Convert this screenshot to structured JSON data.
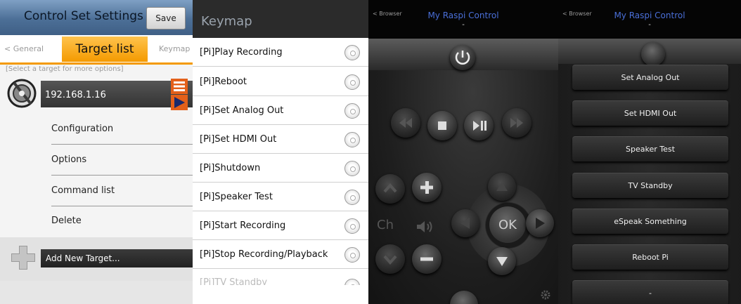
{
  "settings": {
    "title": "Control Set Settings",
    "save_label": "Save",
    "tab_left": "< General",
    "tab_active": "Target list",
    "tab_right": "Keymap >",
    "hint": "[Select a target for more options]",
    "target": "192.168.1.16",
    "sub_items": [
      "Configuration",
      "Options",
      "Command list",
      "Delete"
    ],
    "add_target": "Add New Target...",
    "accent": "#f49a00"
  },
  "keymap": {
    "title": "Keymap",
    "items": [
      "[Pi]Play Recording",
      "[Pi]Reboot",
      "[Pi]Set Analog Out",
      "[Pi]Set HDMI Out",
      "[Pi]Shutdown",
      "[Pi]Speaker Test",
      "[Pi]Start Recording",
      "[Pi]Stop Recording/Playback",
      "[Pi]TV Standby"
    ]
  },
  "remote": {
    "back": "< Browser",
    "title": "My Raspi Control",
    "subtitle": "-",
    "ch_label": "Ch",
    "ok_label": "OK"
  },
  "commands": {
    "back": "< Browser",
    "title": "My Raspi Control",
    "subtitle": "-",
    "buttons": [
      "Set Analog Out",
      "Set HDMI Out",
      "Speaker Test",
      "TV Standby",
      "eSpeak Something",
      "Reboot Pi",
      "-"
    ]
  }
}
